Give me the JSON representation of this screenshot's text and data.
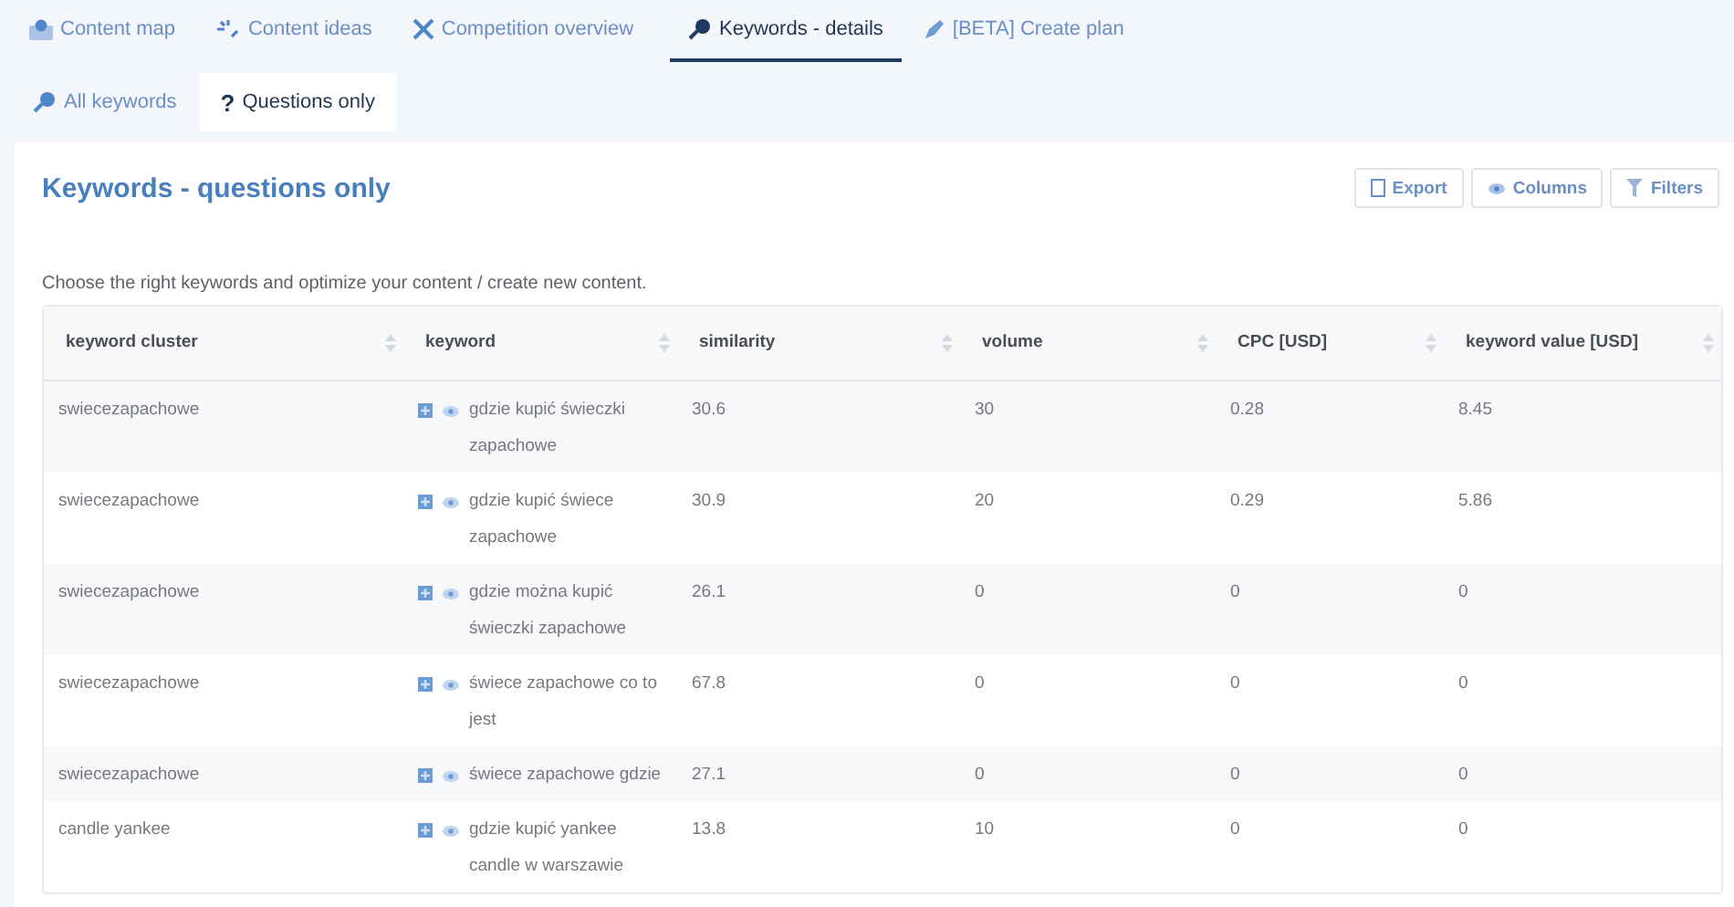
{
  "tabs": [
    {
      "label": "Content map",
      "selected": false
    },
    {
      "label": "Content ideas",
      "selected": false
    },
    {
      "label": "Competition overview",
      "selected": false
    },
    {
      "label": "Keywords - details",
      "selected": true
    },
    {
      "label": "[BETA] Create plan",
      "selected": false
    }
  ],
  "subtabs": [
    {
      "label": "All keywords",
      "selected": false
    },
    {
      "label": "Questions only",
      "icon_text": "?",
      "selected": true
    }
  ],
  "panel": {
    "title": "Keywords - questions only",
    "buttons": [
      {
        "label": "Export"
      },
      {
        "label": "Columns"
      },
      {
        "label": "Filters"
      }
    ],
    "description": "Choose the right keywords and optimize your content / create new content."
  },
  "table": {
    "columns": [
      "keyword cluster",
      "keyword",
      "similarity",
      "volume",
      "CPC [USD]",
      "keyword value [USD]"
    ],
    "rows": [
      {
        "cells": [
          "swiecezapachowe",
          "gdzie kupić świeczki zapachowe",
          "30.6",
          "30",
          "0.28",
          "8.45"
        ]
      },
      {
        "cells": [
          "swiecezapachowe",
          "gdzie kupić świece zapachowe",
          "30.9",
          "20",
          "0.29",
          "5.86"
        ]
      },
      {
        "cells": [
          "swiecezapachowe",
          "gdzie można kupić świeczki zapachowe",
          "26.1",
          "0",
          "0",
          "0"
        ]
      },
      {
        "cells": [
          "swiecezapachowe",
          "świece zapachowe co to jest",
          "67.8",
          "0",
          "0",
          "0"
        ]
      },
      {
        "cells": [
          "swiecezapachowe",
          "świece zapachowe gdzie",
          "27.1",
          "0",
          "0",
          "0"
        ]
      },
      {
        "cells": [
          "candle yankee",
          "gdzie kupić yankee candle w warszawie",
          "13.8",
          "10",
          "0",
          "0"
        ]
      }
    ]
  }
}
